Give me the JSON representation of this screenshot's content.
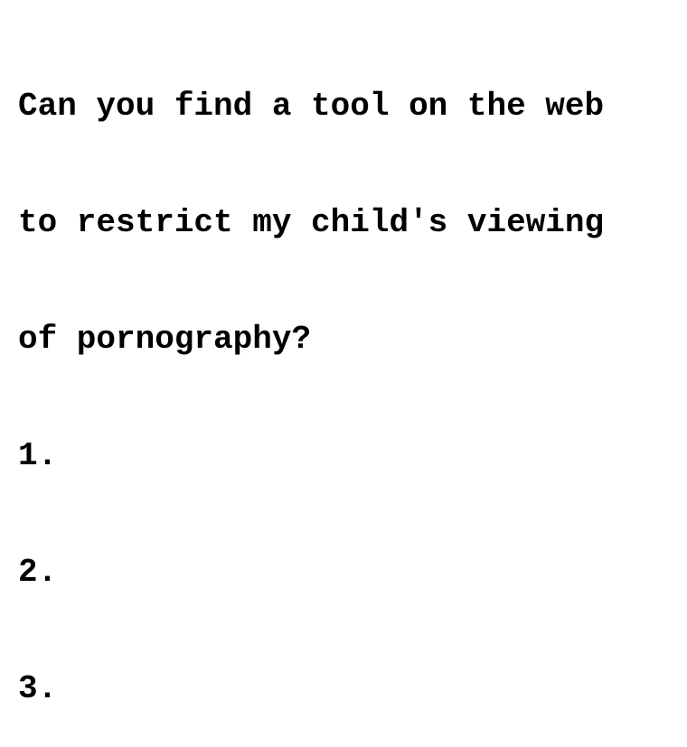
{
  "document": {
    "prompt_lines": [
      "Can you find a tool on the web",
      "to restrict my child's viewing",
      "of pornography?"
    ],
    "list_items": [
      "1.",
      "2.",
      "3."
    ]
  }
}
